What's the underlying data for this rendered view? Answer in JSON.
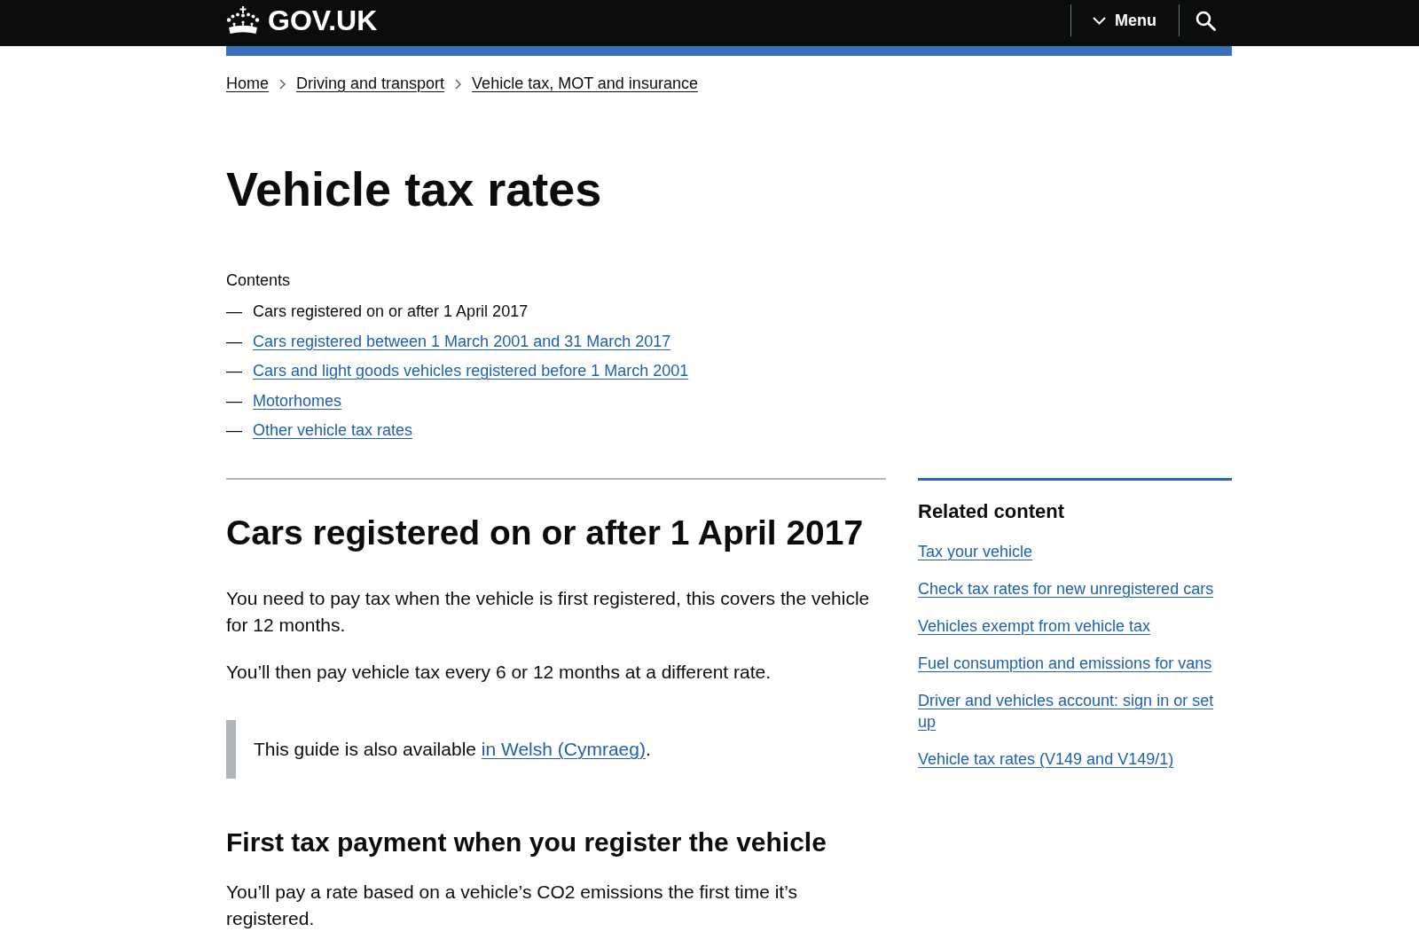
{
  "header": {
    "logo_text": "GOV.UK",
    "menu_label": "Menu"
  },
  "breadcrumbs": [
    {
      "label": "Home"
    },
    {
      "label": "Driving and transport"
    },
    {
      "label": "Vehicle tax, MOT and insurance"
    }
  ],
  "title": "Vehicle tax rates",
  "contents": {
    "heading": "Contents",
    "items": [
      {
        "marker": "—",
        "label": "Cars registered on or after 1 April 2017",
        "selected": true
      },
      {
        "marker": "—",
        "label": "Cars registered between 1 March 2001 and 31 March 2017",
        "selected": false
      },
      {
        "marker": "—",
        "label": "Cars and light goods vehicles registered before 1 March 2001",
        "selected": false
      },
      {
        "marker": "—",
        "label": "Motorhomes",
        "selected": false
      },
      {
        "marker": "—",
        "label": "Other vehicle tax rates",
        "selected": false
      }
    ]
  },
  "article": [
    {
      "kind": "heading",
      "text": "Cars registered on or after 1 April 2017"
    },
    {
      "kind": "paragraph",
      "text": "You need to pay tax when the vehicle is first registered, this covers the vehicle for 12 months."
    },
    {
      "kind": "paragraph",
      "text": "You’ll then pay vehicle tax every 6 or 12 months at a different rate."
    },
    {
      "kind": "inset",
      "text": "This guide is also available ",
      "link": "in Welsh (Cymraeg)",
      "end": "."
    },
    {
      "kind": "subheading",
      "text": "First tax payment when you register the vehicle"
    },
    {
      "kind": "paragraph",
      "text": "You’ll pay a rate based on a vehicle’s CO2 emissions the first time it’s registered."
    }
  ],
  "related": {
    "heading": "Related content",
    "links": [
      "Tax your vehicle",
      "Check tax rates for new unregistered cars",
      "Vehicles exempt from vehicle tax",
      "Fuel consumption and emissions for vans",
      "Driver and vehicles account: sign in or set up",
      "Vehicle tax rates (V149 and V149/1)"
    ]
  }
}
